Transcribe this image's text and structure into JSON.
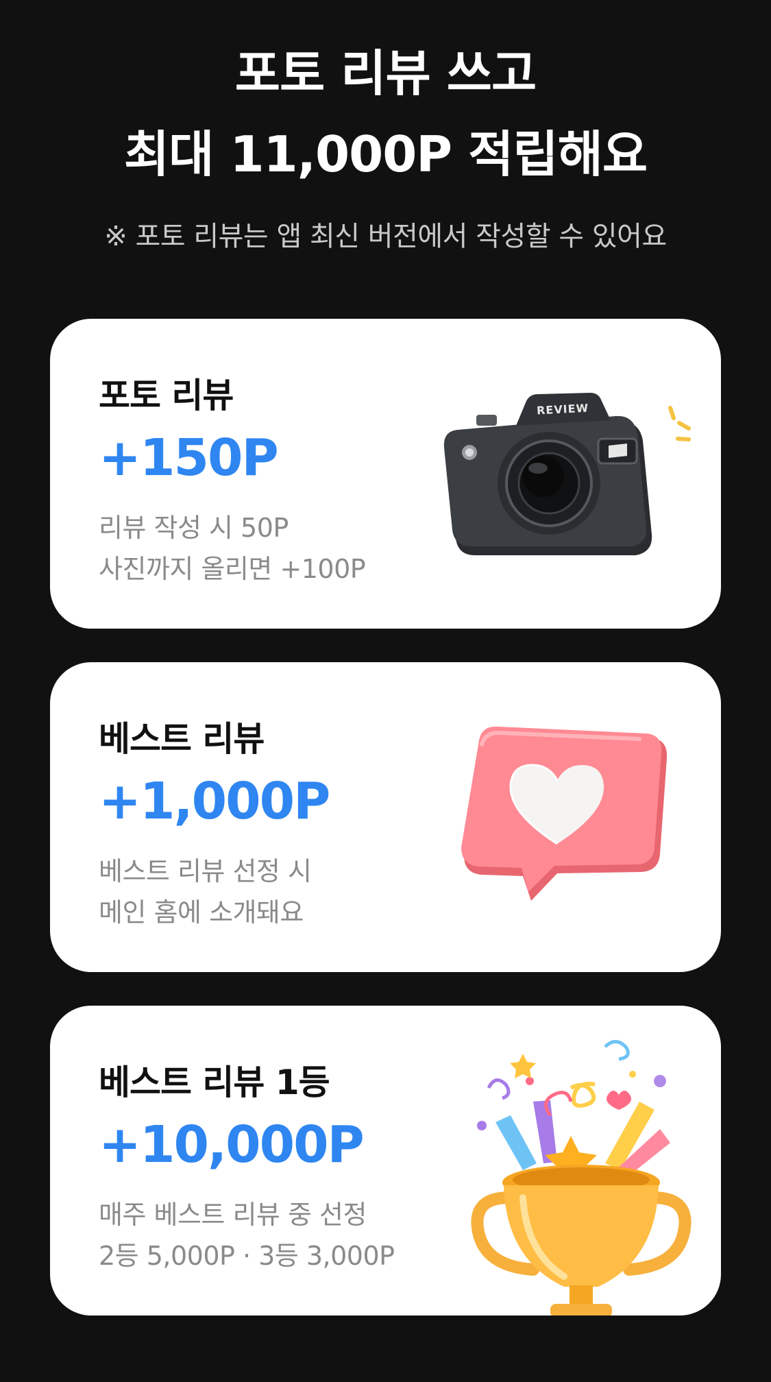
{
  "header": {
    "title_line1": "포토 리뷰 쓰고",
    "title_line2": "최대 11,000P 적립해요",
    "notice": "※ 포토 리뷰는 앱 최신 버전에서 작성할 수 있어요"
  },
  "cards": [
    {
      "title": "포토 리뷰",
      "points": "+150P",
      "desc_line1": "리뷰 작성 시 50P",
      "desc_line2": "사진까지 올리면 +100P",
      "icon": "camera-icon",
      "icon_text": "REVIEW"
    },
    {
      "title": "베스트 리뷰",
      "points": "+1,000P",
      "desc_line1": "베스트 리뷰 선정 시",
      "desc_line2": "메인 홈에 소개돼요",
      "icon": "heart-bubble-icon"
    },
    {
      "title": "베스트 리뷰 1등",
      "points": "+10,000P",
      "desc_line1": "매주 베스트 리뷰 중 선정",
      "desc_line2": "2등 5,000P · 3등 3,000P",
      "icon": "trophy-icon"
    }
  ],
  "colors": {
    "background": "#111111",
    "card": "#ffffff",
    "accent_blue": "#2f86f1",
    "desc_gray": "#8a8a8a"
  }
}
